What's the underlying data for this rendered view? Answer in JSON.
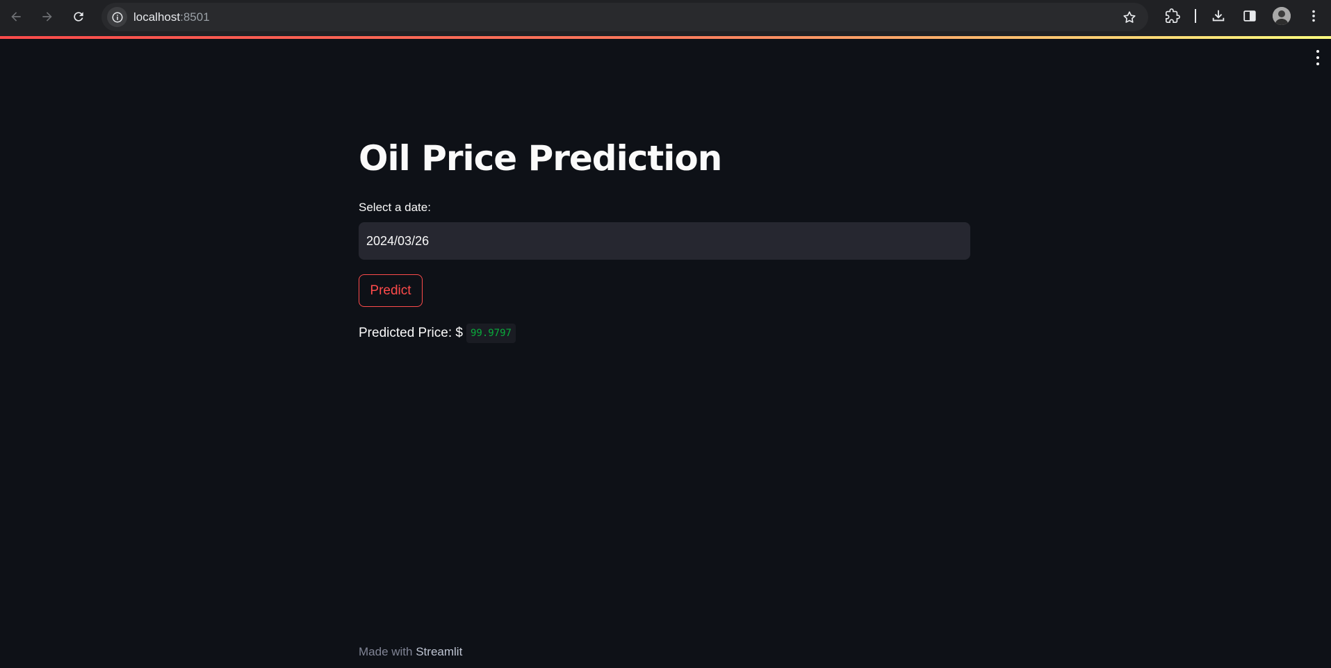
{
  "browser": {
    "url_host": "localhost",
    "url_port": ":8501",
    "icons": [
      "back-icon",
      "forward-icon",
      "reload-icon",
      "site-info-icon",
      "bookmark-star-icon",
      "extensions-icon",
      "downloads-icon",
      "side-panel-icon",
      "profile-avatar",
      "browser-menu-icon"
    ]
  },
  "app": {
    "title": "Oil Price Prediction",
    "date_label": "Select a date:",
    "date_value": "2024/03/26",
    "predict_label": "Predict",
    "result_prefix": "Predicted Price: $",
    "result_value": "99.9797",
    "footer_prefix": "Made with",
    "footer_brand": "Streamlit"
  },
  "colors": {
    "background": "#0e1117",
    "accent": "#ff4b4b",
    "input_bg": "#262730",
    "code_green": "#09ab3b"
  }
}
